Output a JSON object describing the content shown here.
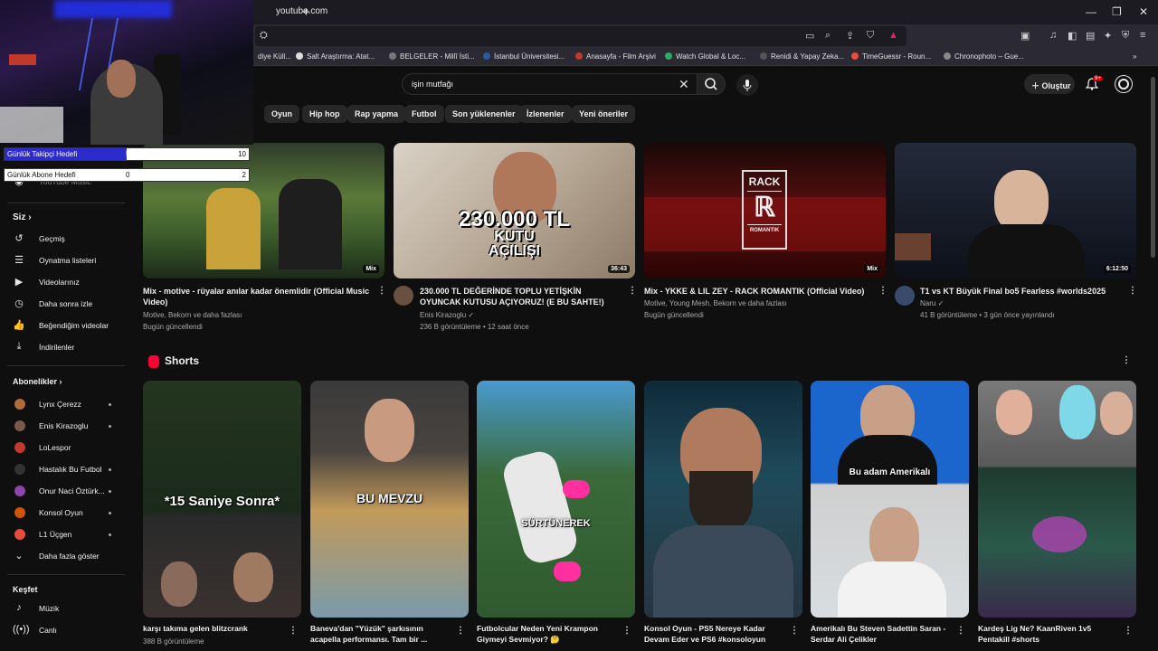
{
  "browser": {
    "url": "youtube.com",
    "new_tab": "+",
    "bookmarks": [
      {
        "label": "diye Küll..."
      },
      {
        "label": "Salt Araştırma: Atat..."
      },
      {
        "label": "BELGELER - Millî İsti..."
      },
      {
        "label": "İstanbul Üniversitesi..."
      },
      {
        "label": "Anasayfa - Film Arşivi"
      },
      {
        "label": "Watch Global & Loc..."
      },
      {
        "label": "Renidi & Yapay Zeka..."
      },
      {
        "label": "TimeGuessr - Roun..."
      },
      {
        "label": "Chronophoto – Gue..."
      }
    ],
    "bookmarks_more": "»"
  },
  "header": {
    "search_query": "işin mutfağı",
    "create_label": "Oluştur",
    "notif_badge": "9+"
  },
  "chips": [
    "Oyun",
    "Hip hop",
    "Rap yapma",
    "Futbol",
    "Son yüklenenler",
    "İzlenenler",
    "Yeni öneriler"
  ],
  "overlay": {
    "goals": [
      {
        "label": "Günlük Takipçi Hedefi",
        "current": "5",
        "max": "10",
        "progress": 0.5
      },
      {
        "label": "Günlük Abone Hedefi",
        "current": "0",
        "max": "2",
        "progress": 0.0
      }
    ]
  },
  "sidebar": {
    "partial_item": "YouTube Music",
    "you_heading": "Siz",
    "you_items": [
      {
        "label": "Geçmiş",
        "icon": "history-icon"
      },
      {
        "label": "Oynatma listeleri",
        "icon": "playlist-icon"
      },
      {
        "label": "Videolarınız",
        "icon": "your-videos-icon"
      },
      {
        "label": "Daha sonra izle",
        "icon": "watch-later-icon"
      },
      {
        "label": "Beğendiğim videolar",
        "icon": "liked-icon"
      },
      {
        "label": "İndirilenler",
        "icon": "download-icon"
      }
    ],
    "subs_heading": "Abonelikler",
    "subs": [
      {
        "label": "Lynx Çerezz",
        "color": "#b06a3b"
      },
      {
        "label": "Enis Kirazoglu",
        "color": "#7a5a48"
      },
      {
        "label": "LoLespor",
        "color": "#c0392b"
      },
      {
        "label": "Hastalık Bu Futbol",
        "color": "#222222"
      },
      {
        "label": "Onur Naci Öztürk...",
        "color": "#8e44ad"
      },
      {
        "label": "Konsol Oyun",
        "color": "#d35400"
      },
      {
        "label": "L1 Üçgen",
        "color": "#e74c3c"
      }
    ],
    "show_more": "Daha fazla göster",
    "explore_heading": "Keşfet",
    "explore": [
      {
        "label": "Müzik",
        "icon": "music-icon"
      },
      {
        "label": "Canlı",
        "icon": "live-icon"
      }
    ]
  },
  "videos": [
    {
      "title": "Mix - motive - rüyalar anılar kadar önemlidir (Official Music Video)",
      "meta1": "Motive, Bekorn ve daha fazlası",
      "meta2": "Bugün güncellendi",
      "badge": "Mix"
    },
    {
      "title": "230.000 TL DEĞERİNDE TOPLU YETİŞKİN OYUNCAK KUTUSU AÇIYORUZ! (E BU SAHTE!)",
      "meta1": "Enis Kirazoglu",
      "meta2": "236 B görüntüleme • 12 saat önce",
      "badge": "36:43",
      "thumb_text": [
        "230.000 TL",
        "KUTU",
        "AÇILIŞI"
      ]
    },
    {
      "title": "Mix - YKKE & LIL ZEY - RACK ROMANTIK (Official Video)",
      "meta1": "Motive, Young Mesh, Bekorn ve daha fazlası",
      "meta2": "Bugün güncellendi",
      "badge": "Mix",
      "thumb_text": [
        "RACK",
        "ROMANTIK"
      ]
    },
    {
      "title": "T1 vs KT Büyük Final bo5 Fearless #worlds2025",
      "meta1": "Naru",
      "meta2": "41 B görüntüleme • 3 gün önce yayınlandı",
      "badge": "6:12:50"
    }
  ],
  "shorts": {
    "heading": "Shorts",
    "items": [
      {
        "title": "karşı takıma gelen blitzcrank",
        "meta": "388 B görüntüleme",
        "caption": "*15 Saniye Sonra*"
      },
      {
        "title": "Baneva'dan \"Yüzük\" şarkısının acapella performansı. Tam bir ...",
        "caption": "BU MEVZU"
      },
      {
        "title": "Futbolcular Neden Yeni Krampon Giymeyi Sevmiyor? 🤔",
        "caption": "SÜRTÜNEREK"
      },
      {
        "title": "Konsol Oyun - PS5 Nereye Kadar Devam Eder ve PS6 #konsoloyun"
      },
      {
        "title": "Amerikalı Bu Steven Sadettin Saran - Serdar Ali Çelikler",
        "caption": "Bu adam Amerikalı"
      },
      {
        "title": "Kardeş Lig Ne? KaanRiven 1v5 Pentakill #shorts"
      }
    ]
  }
}
